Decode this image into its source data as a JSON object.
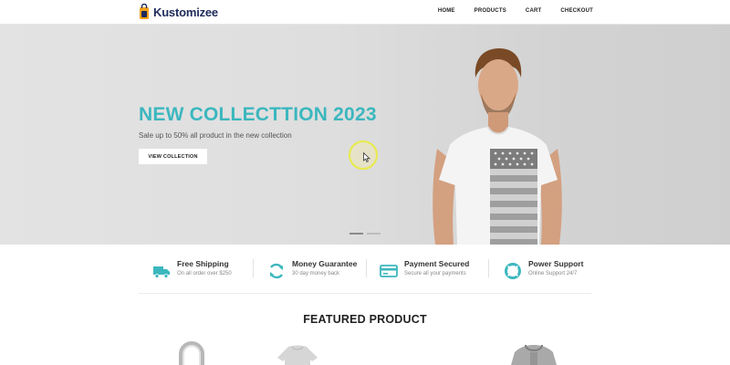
{
  "header": {
    "logo_text": "Kustomizee",
    "nav": [
      {
        "label": "HOME"
      },
      {
        "label": "PRODUCTS"
      },
      {
        "label": "CART"
      },
      {
        "label": "CHECKOUT"
      }
    ]
  },
  "hero": {
    "title": "NEW COLLECTTION 2023",
    "subtitle": "Sale up to 50% all product in the new collection",
    "button_label": "VIEW COLLECTION",
    "slides_total": 2,
    "active_slide": 1
  },
  "features": [
    {
      "title": "Free Shipping",
      "subtitle": "On all order over $250",
      "icon": "truck-icon"
    },
    {
      "title": "Money Guarantee",
      "subtitle": "30 day money back",
      "icon": "refresh-icon"
    },
    {
      "title": "Payment Secured",
      "subtitle": "Secure all your payments",
      "icon": "credit-card-icon"
    },
    {
      "title": "Power Support",
      "subtitle": "Online Support 24/7",
      "icon": "lifebuoy-icon"
    }
  ],
  "featured": {
    "title": "FEATURED PRODUCT"
  },
  "colors": {
    "accent": "#3cb7be",
    "logo": "#1e2a5a",
    "cursor_highlight": "#e9ea4a"
  }
}
